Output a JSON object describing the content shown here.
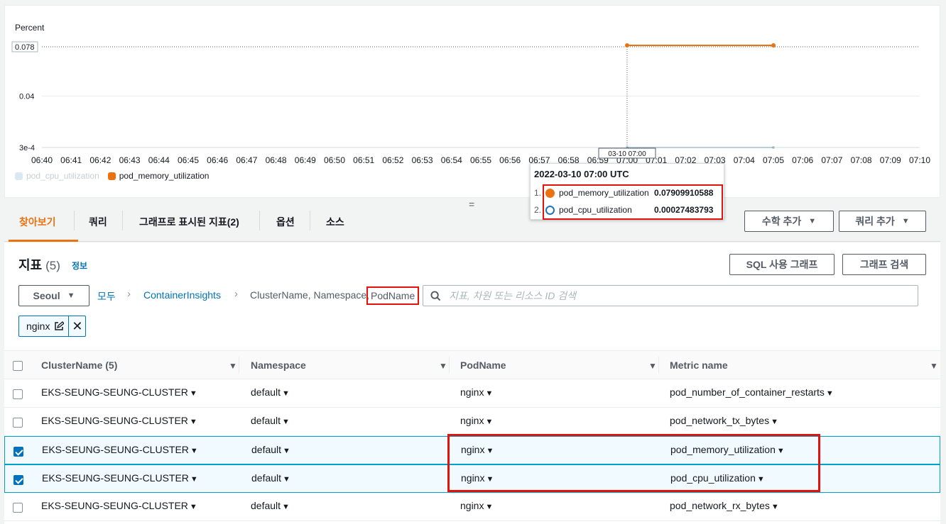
{
  "chart": {
    "y_unit": "Percent",
    "y_ticks": [
      "0.078",
      "0.04",
      "3e-4"
    ],
    "x_ticks": [
      "06:40",
      "06:41",
      "06:42",
      "06:43",
      "06:44",
      "06:45",
      "06:46",
      "06:47",
      "06:48",
      "06:49",
      "06:50",
      "06:51",
      "06:52",
      "06:53",
      "06:54",
      "06:55",
      "06:56",
      "06:57",
      "06:58",
      "06:59",
      "07:00",
      "07:01",
      "07:02",
      "07:03",
      "07:04",
      "07:05",
      "07:06",
      "07:07",
      "07:08",
      "07:09",
      "07:10"
    ],
    "cursor_label": "03-10 07:00",
    "legend": [
      {
        "name": "pod_cpu_utilization",
        "color": "#cfe0ec",
        "muted": true
      },
      {
        "name": "pod_memory_utilization",
        "color": "#ec7211",
        "muted": false
      }
    ]
  },
  "chart_data": {
    "type": "line",
    "title": "",
    "ylabel": "Percent",
    "ylim": [
      0.0003,
      0.078
    ],
    "series": [
      {
        "name": "pod_memory_utilization",
        "color": "#ec7211",
        "points": [
          [
            "07:00",
            0.07909910588
          ],
          [
            "07:05",
            0.07909910588
          ]
        ]
      },
      {
        "name": "pod_cpu_utilization",
        "color": "#1f77b4",
        "points": [
          [
            "07:00",
            0.00027483793
          ],
          [
            "07:05",
            0.00027483793
          ]
        ]
      }
    ]
  },
  "tooltip": {
    "title": "2022-03-10 07:00 UTC",
    "rows": [
      {
        "index": "1.",
        "name": "pod_memory_utilization",
        "value": "0.07909910588",
        "color": "#ec7211"
      },
      {
        "index": "2.",
        "name": "pod_cpu_utilization",
        "value": "0.00027483793",
        "color": "#1f77b4"
      }
    ]
  },
  "splitter": "=",
  "tabs": [
    {
      "label": "찾아보기",
      "active": true
    },
    {
      "label": "쿼리",
      "active": false
    },
    {
      "label": "그래프로 표시된 지표(2)",
      "active": false
    },
    {
      "label": "옵션",
      "active": false
    },
    {
      "label": "소스",
      "active": false
    }
  ],
  "toolbar": {
    "math_label": "수학 추가",
    "query_label": "쿼리 추가"
  },
  "metrics": {
    "title": "지표",
    "count": "(5)",
    "info": "정보",
    "sql_button": "SQL 사용 그래프",
    "search_graph_button": "그래프 검색",
    "region": "Seoul",
    "breadcrumb": {
      "all": "모두",
      "namespace": "ContainerInsights",
      "dims": "ClusterName, Namespace,",
      "last": "PodName"
    },
    "search_placeholder": "지표, 차원 또는 리소스 ID 검색",
    "filter_token": "nginx"
  },
  "table": {
    "headers": [
      "ClusterName  (5)",
      "Namespace",
      "PodName",
      "Metric name"
    ],
    "rows": [
      {
        "cluster": "EKS-SEUNG-SEUNG-CLUSTER",
        "namespace": "default",
        "pod": "nginx",
        "metric": "pod_number_of_container_restarts",
        "checked": false
      },
      {
        "cluster": "EKS-SEUNG-SEUNG-CLUSTER",
        "namespace": "default",
        "pod": "nginx",
        "metric": "pod_network_tx_bytes",
        "checked": false
      },
      {
        "cluster": "EKS-SEUNG-SEUNG-CLUSTER",
        "namespace": "default",
        "pod": "nginx",
        "metric": "pod_memory_utilization",
        "checked": true
      },
      {
        "cluster": "EKS-SEUNG-SEUNG-CLUSTER",
        "namespace": "default",
        "pod": "nginx",
        "metric": "pod_cpu_utilization",
        "checked": true
      },
      {
        "cluster": "EKS-SEUNG-SEUNG-CLUSTER",
        "namespace": "default",
        "pod": "nginx",
        "metric": "pod_network_rx_bytes",
        "checked": false
      }
    ]
  }
}
